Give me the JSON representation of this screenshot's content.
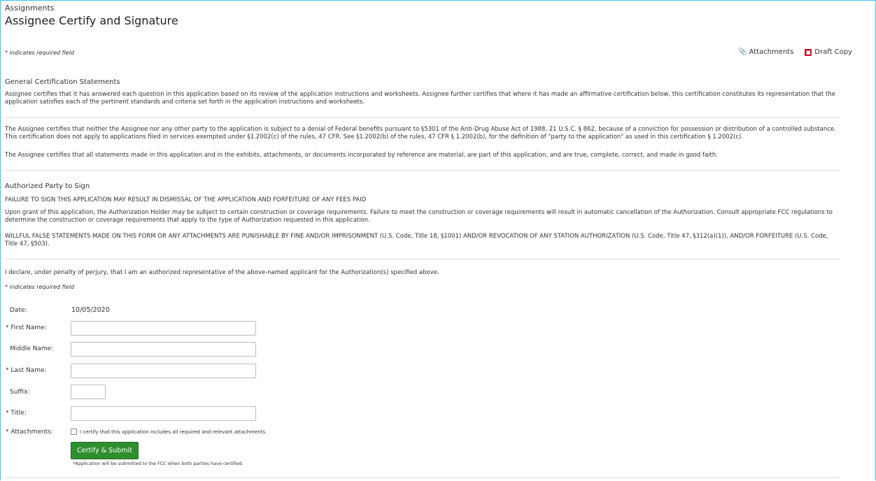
{
  "breadcrumb": "Assignments",
  "page_title": "Assignee Certify and Signature",
  "required_note": "* indicates required field",
  "links": {
    "attachments": "Attachments",
    "draft_copy": "Draft Copy"
  },
  "general": {
    "heading": "General Certification Statements",
    "p1": "Assignee certifies that it has answered each question in this application based on its review of the application instructions and worksheets. Assignee further certifies that where it has made an affirmative certification below, this certification constitutes its representation that the application satisfies each of the pertinent standards and criteria set forth in the application instructions and worksheets.",
    "p2": "The Assignee certifies that neither the Assignee nor any other party to the application is subject to a denial of Federal benefits pursuant to §5301 of the Anti-Drug Abuse Act of 1988, 21 U.S.C. § 862, because of a conviction for possession or distribution of a controlled substance. This certification does not apply to applications filed in services exempted under §1.2002(c) of the rules, 47 CFR. See §1.2002(b) of the rules, 47 CFR § 1.2002(b), for the definition of \"party to the application\" as used in this certification § 1.2002(c).",
    "p3": "The Assignee certifies that all statements made in this application and in the exhibits, attachments, or documents incorporated by reference are material, are part of this application, and are true, complete, correct, and made in good faith."
  },
  "authorized": {
    "heading": "Authorized Party to Sign",
    "warning": "FAILURE TO SIGN THIS APPLICATION MAY RESULT IN DISMISSAL OF THE APPLICATION AND FORFEITURE OF ANY FEES PAID",
    "p1": "Upon grant of this application, the Authorization Holder may be subject to certain construction or coverage requirements. Failure to meet the construction or coverage requirements will result in automatic cancellation of the Authorization. Consult appropriate FCC regulations to determine the construction or coverage requirements that apply to the type of Authorization requested in this application.",
    "p2": "WILLFUL FALSE STATEMENTS MADE ON THIS FORM OR ANY ATTACHMENTS ARE PUNISHABLE BY FINE AND/OR IMPRISONMENT (U.S. Code, Title 18, §1001) AND/OR REVOCATION OF ANY STATION AUTHORIZATION (U.S. Code, Title 47, §312(a)(1)), AND/OR FORFEITURE (U.S. Code, Title 47, §503)."
  },
  "declare": "I declare, under penalty of perjury, that I am an authorized representative of the above-named applicant for the Authorization(s) specified above.",
  "form": {
    "date_label": "Date:",
    "date_value": "10/05/2020",
    "first_label": "* First Name:",
    "first_value": "",
    "middle_label": "Middle Name:",
    "middle_value": "",
    "last_label": "* Last Name:",
    "last_value": "",
    "suffix_label": "Suffix:",
    "suffix_value": "",
    "title_label": "* Title:",
    "title_value": "",
    "attach_label": "* Attachments:",
    "attach_cb_label": "I certify that this application includes all required and relevant attachments.",
    "submit_label": "Certify & Submit",
    "submit_note": "*Application will be submitted to the FCC when both parties have certified."
  },
  "colors": {
    "frame": "#39c7e8",
    "submit": "#2f8f2f",
    "pdf": "#c8102e"
  },
  "icons": {
    "attachments": "paperclip-icon",
    "draft_copy": "pdf-icon"
  }
}
